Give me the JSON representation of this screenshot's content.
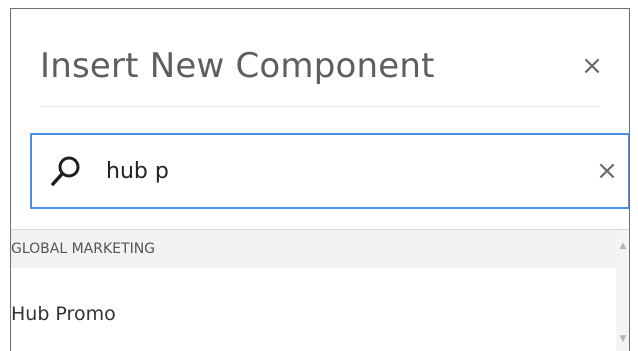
{
  "dialog": {
    "title": "Insert New Component",
    "close_label": "×"
  },
  "search": {
    "value": "hub p",
    "clear_label": "×"
  },
  "results": {
    "groups": [
      {
        "label": "GLOBAL MARKETING",
        "items": [
          {
            "label": "Hub Promo"
          }
        ]
      }
    ]
  },
  "scrollbar": {
    "up_label": "▲",
    "down_label": "▼"
  },
  "colors": {
    "focus_border": "#4c8ee8",
    "title_text": "#5e5e5e",
    "group_header_bg": "#f2f2f2"
  },
  "icons": {
    "search": "search-icon",
    "close": "close-icon",
    "clear": "clear-icon"
  }
}
